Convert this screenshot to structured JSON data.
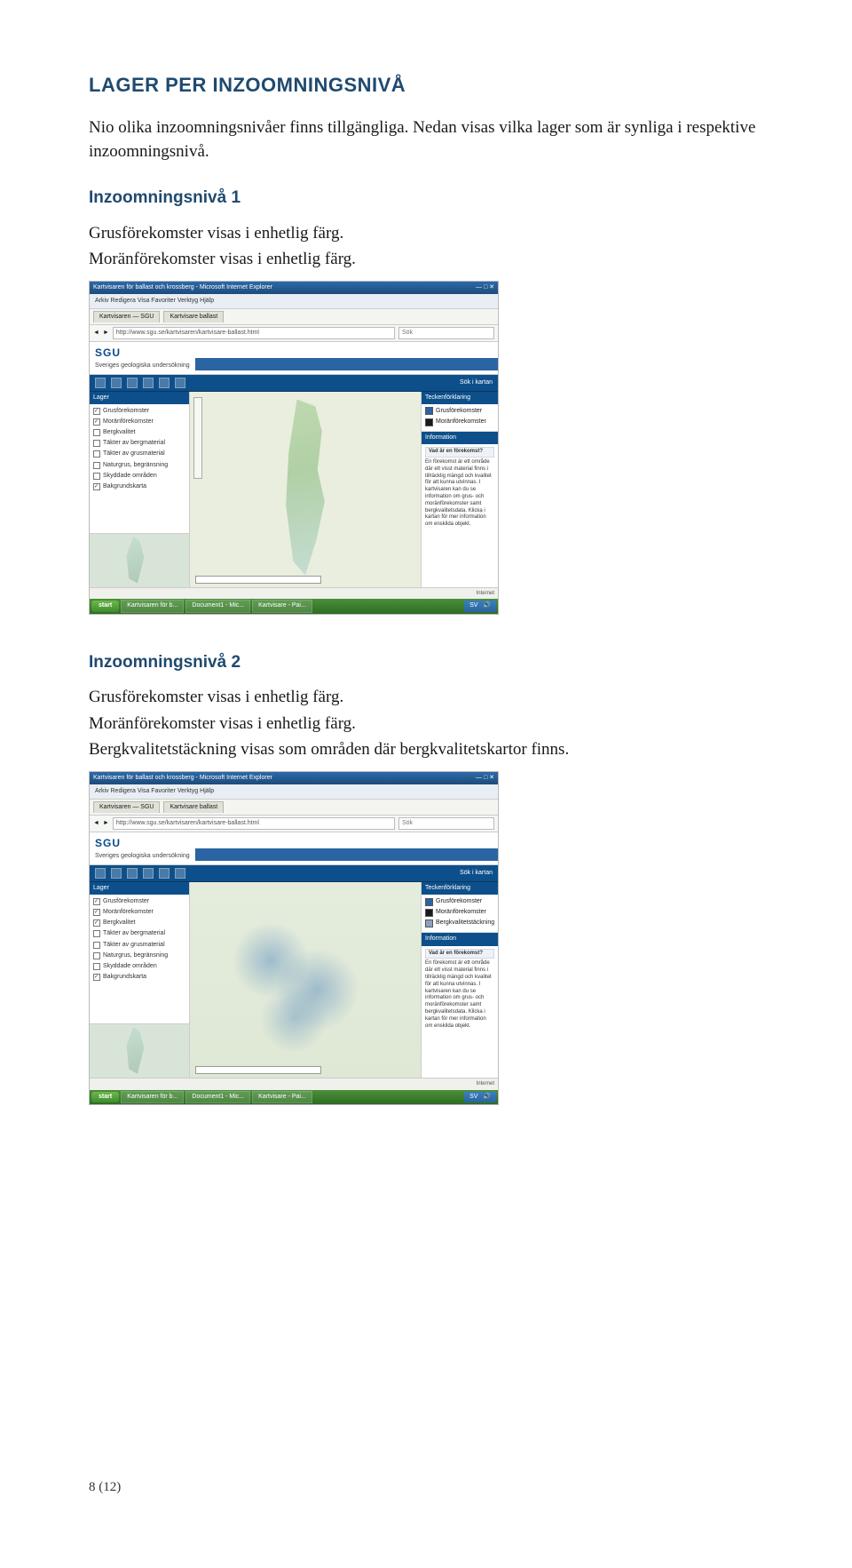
{
  "section_title": "LAGER PER INZOOMNINGSNIVÅ",
  "intro_paragraph": "Nio olika inzoomningsnivåer finns tillgängliga. Nedan visas vilka lager som är synliga i respektive inzoomningsnivå.",
  "level1": {
    "heading": "Inzoomningsnivå 1",
    "line1": "Grusförekomster visas i enhetlig färg.",
    "line2": "Moränförekomster visas i enhetlig färg."
  },
  "level2": {
    "heading": "Inzoomningsnivå 2",
    "line1": "Grusförekomster visas i enhetlig färg.",
    "line2": "Moränförekomster visas i enhetlig färg.",
    "line3": "Bergkvalitetstäckning visas som områden där bergkvalitetskartor finns."
  },
  "footer": "8 (12)",
  "browser": {
    "titlebar": "Kartvisaren för ballast och krossberg - Microsoft Internet Explorer",
    "menu": "Arkiv   Redigera   Visa   Favoriter   Verktyg   Hjälp",
    "url": "http://www.sgu.se/kartvisaren/kartvisare-ballast.html",
    "search_placeholder": "Sök",
    "searchmap": "Sök i kartan",
    "tabs": [
      "Kartvisaren — SGU",
      "Kartvisare ballast"
    ]
  },
  "sgu": {
    "logo": "SGU",
    "subtitle": "Sveriges geologiska undersökning"
  },
  "panes": {
    "layers_title": "Lager",
    "info_title": "Information",
    "legend_title": "Teckenförklaring"
  },
  "layers1": [
    "Grusförekomster",
    "Moränförekomster",
    "Bergkvalitet",
    "Täkter av bergmaterial",
    "Täkter av grusmaterial",
    "Naturgrus, begränsning",
    "Skyddade områden",
    "Bakgrundskarta"
  ],
  "legend1": [
    {
      "label": "Grusförekomster",
      "color": "#2b64a3"
    },
    {
      "label": "Moränförekomster",
      "color": "#1a1a1a"
    }
  ],
  "legend2": [
    {
      "label": "Grusförekomster",
      "color": "#2b64a3"
    },
    {
      "label": "Moränförekomster",
      "color": "#1a1a1a"
    },
    {
      "label": "Bergkvalitetstäckning",
      "color": "#8aa2bd"
    }
  ],
  "info": {
    "head": "Vad är en förekomst?",
    "body": "En förekomst är ett område där ett visst material finns i tillräcklig mängd och kvalitet för att kunna utvinnas. I kartvisaren kan du se information om grus- och moränförekomster samt bergkvalitetsdata. Klicka i kartan för mer information om enskilda objekt."
  },
  "taskbar": {
    "start": "start",
    "items": [
      "Kartvisaren för b...",
      "Document1 - Mic...",
      "Kartvisare - Pai..."
    ]
  }
}
